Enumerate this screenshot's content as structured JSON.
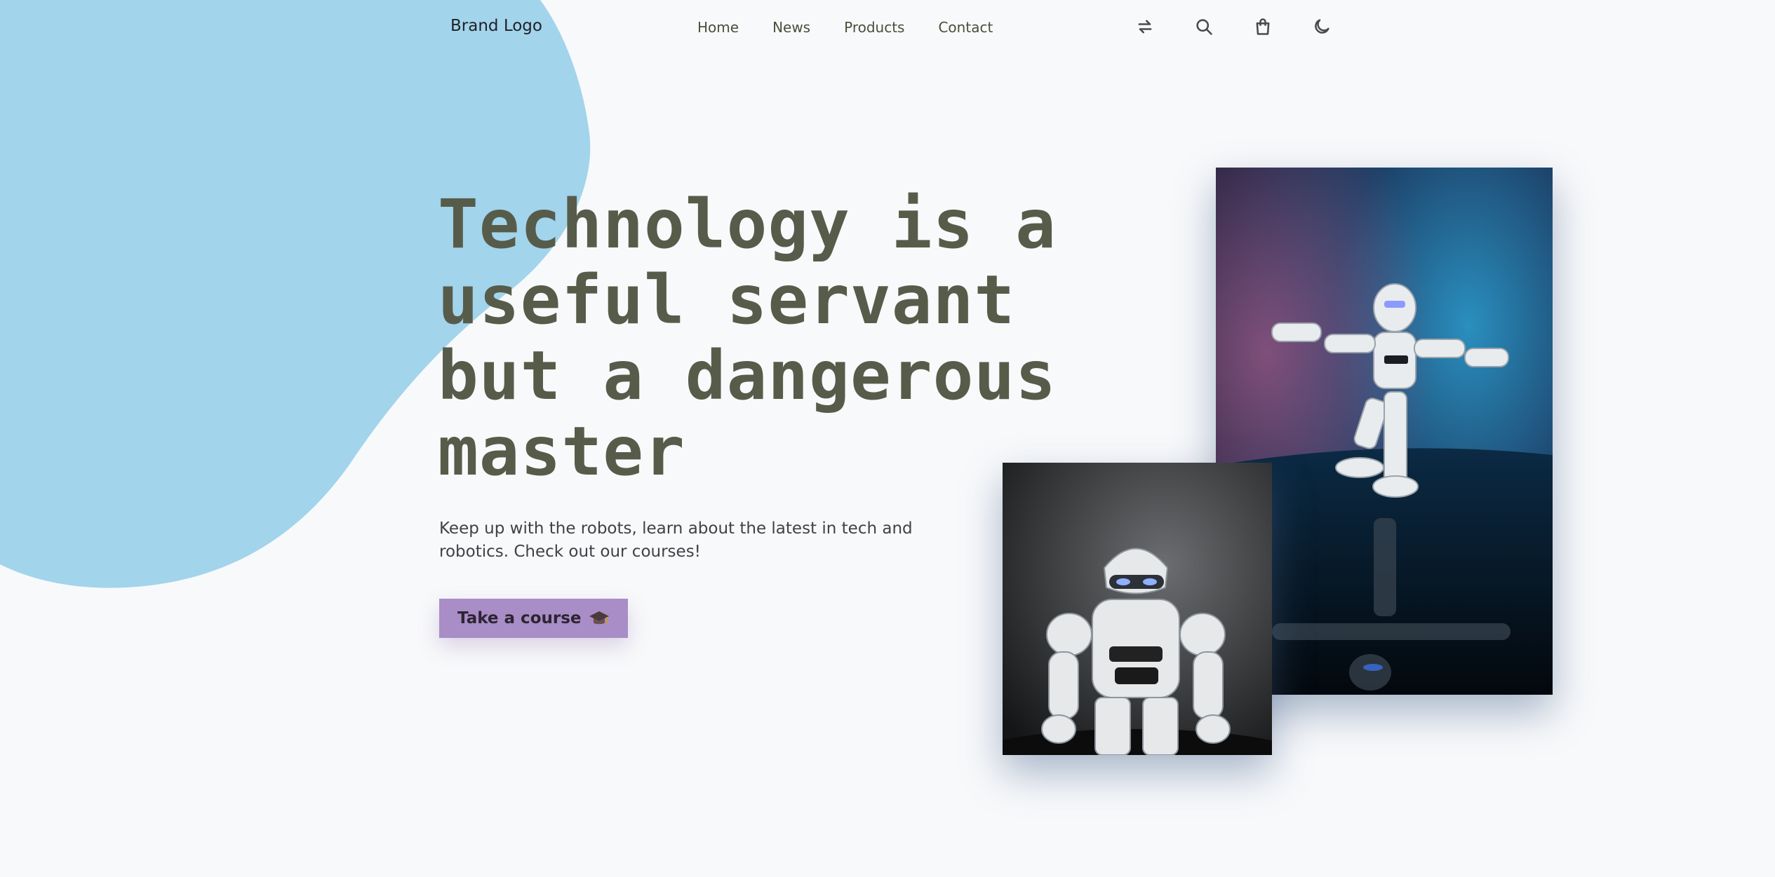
{
  "header": {
    "brand": "Brand Logo",
    "nav": [
      "Home",
      "News",
      "Products",
      "Contact"
    ],
    "icons": [
      "arrows-swap-icon",
      "search-icon",
      "shopping-bag-icon",
      "moon-icon"
    ]
  },
  "hero": {
    "headline": "Technology is a useful servant but a dangerous master",
    "subtext": "Keep up with the robots, learn about the latest in tech and robotics. Check out our courses!",
    "cta_label": "Take a course",
    "cta_icon": "graduation-cap-icon"
  },
  "images": [
    {
      "name": "robot-balancing-photo",
      "alt": "White humanoid robot balancing on one leg against a blue and purple background"
    },
    {
      "name": "robot-standing-photo",
      "alt": "White humanoid robot standing against a dark grey background"
    }
  ],
  "colors": {
    "background": "#f8f9fb",
    "blob": "#a2d4ec",
    "headline": "#575c4a",
    "button": "#a98dc6",
    "nav_text": "#4a4f3a"
  }
}
